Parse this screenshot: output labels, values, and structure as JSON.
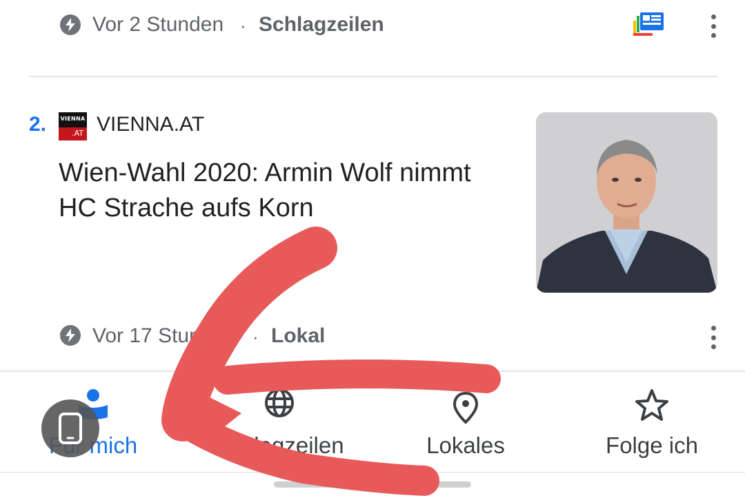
{
  "top_item": {
    "time": "Vor 2 Stunden",
    "separator": "·",
    "category": "Schlagzeilen"
  },
  "article": {
    "rank": "2.",
    "source_logo": {
      "top": "VIENNA",
      "bottom": ".AT"
    },
    "source": "VIENNA.AT",
    "headline": "Wien-Wahl 2020: Armin Wolf nimmt HC Strache aufs Korn",
    "time": "Vor 17 Stunden",
    "separator": "·",
    "category": "Lokal"
  },
  "bottom_nav": {
    "items": [
      {
        "label": "Für mich",
        "icon": "for-you-icon",
        "active": true
      },
      {
        "label": "Schlagzeilen",
        "icon": "globe-icon",
        "active": false
      },
      {
        "label": "Lokales",
        "icon": "location-pin-icon",
        "active": false
      },
      {
        "label": "Folge ich",
        "icon": "star-icon",
        "active": false
      }
    ]
  },
  "colors": {
    "accent": "#1a73e8",
    "annotation": "#e85a5a",
    "text_secondary": "#5f6368"
  }
}
